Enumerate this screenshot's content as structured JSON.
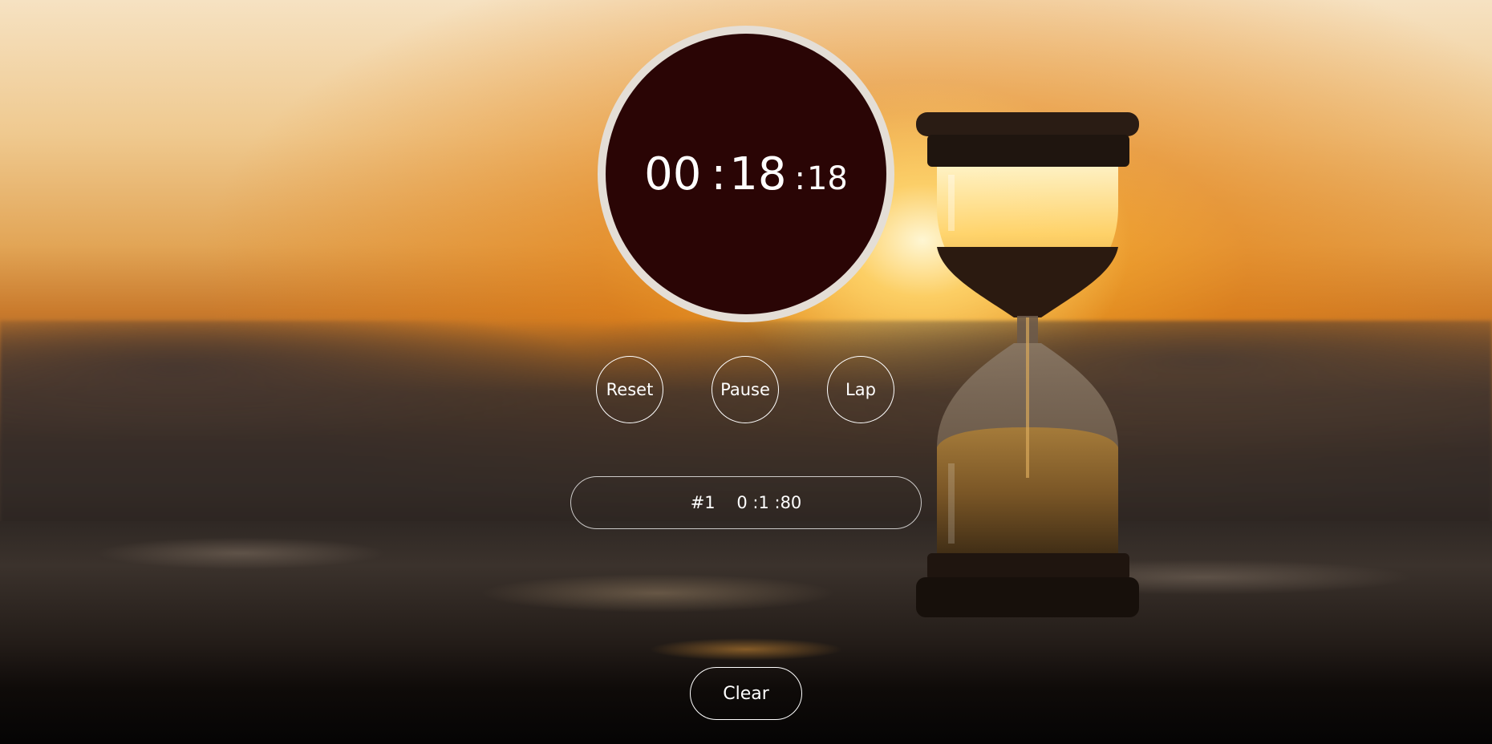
{
  "stopwatch": {
    "hours": "00",
    "minutes": "18",
    "centiseconds": "18",
    "separator": ":"
  },
  "controls": {
    "reset_label": "Reset",
    "pause_label": "Pause",
    "lap_label": "Lap"
  },
  "laps": [
    {
      "number": "#1",
      "time": "0 :1 :80"
    }
  ],
  "clear_label": "Clear",
  "colors": {
    "dial_face": "#2a0505",
    "dial_ring": "#e4ded6",
    "text": "#ffffff"
  },
  "background_image": "hourglass-sunset"
}
